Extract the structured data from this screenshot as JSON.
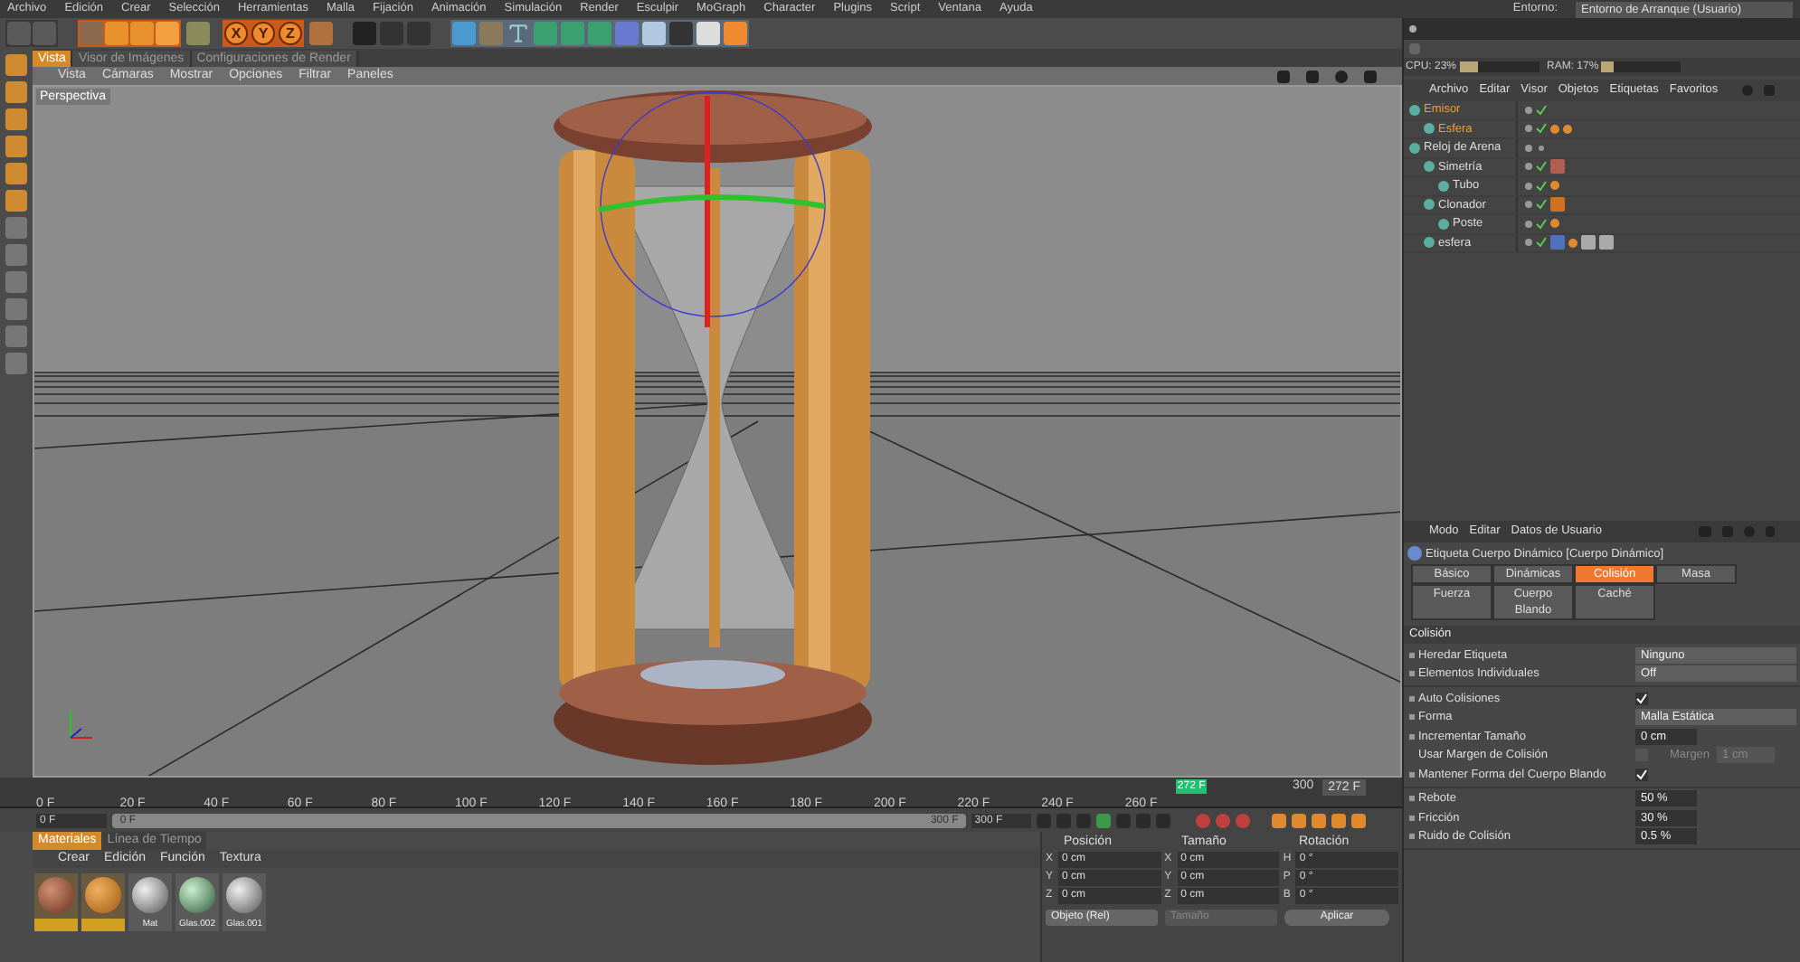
{
  "menu_bar": [
    "Archivo",
    "Edición",
    "Crear",
    "Selección",
    "Herramientas",
    "Malla",
    "Fijación",
    "Animación",
    "Simulación",
    "Render",
    "Esculpir",
    "MoGraph",
    "Character",
    "Plugins",
    "Script",
    "Ventana",
    "Ayuda"
  ],
  "environment": {
    "label": "Entorno:",
    "value": "Entorno de Arranque (Usuario)"
  },
  "axis_locks": [
    {
      "label": "X",
      "on": true
    },
    {
      "label": "Y",
      "on": true
    },
    {
      "label": "Z",
      "on": true
    }
  ],
  "viewport_tabs": [
    {
      "label": "Vista",
      "selected": true
    },
    {
      "label": "Visor de Imágenes",
      "selected": false
    },
    {
      "label": "Configuraciones de Render",
      "selected": false
    }
  ],
  "viewport_menu": [
    "Vista",
    "Cámaras",
    "Mostrar",
    "Opciones",
    "Filtrar",
    "Paneles"
  ],
  "viewport_label": "Perspectiva",
  "timeline": {
    "ticks": [
      "0 F",
      "20 F",
      "40 F",
      "60 F",
      "80 F",
      "100 F",
      "120 F",
      "140 F",
      "160 F",
      "180 F",
      "200 F",
      "220 F",
      "240 F",
      "260 F"
    ],
    "last_tick": "300",
    "marker": "272 F",
    "level": 0.907,
    "current": "272 F"
  },
  "range": {
    "start": "0 F",
    "slider_start": "0 F",
    "slider_end": "300 F",
    "end": "300 F",
    "level": 1
  },
  "meters": [
    {
      "label": "CPU: 23%",
      "level": 0.23
    },
    {
      "label": "RAM: 17%",
      "level": 0.17
    }
  ],
  "object_menu": [
    "Archivo",
    "Editar",
    "Visor",
    "Objetos",
    "Etiquetas",
    "Favoritos"
  ],
  "objects": [
    {
      "name": "Emisor",
      "selected": true,
      "checked": true,
      "children": [
        {
          "name": "Esfera",
          "selected": true,
          "checked": true,
          "tags": [
            {
              "kind": "phong"
            },
            {
              "kind": "dynamics"
            }
          ]
        }
      ]
    },
    {
      "name": "Reloj de Arena",
      "selected": false,
      "checked": false,
      "children": [
        {
          "name": "Simetría",
          "selected": false,
          "checked": true,
          "tags": [
            {
              "kind": "material"
            }
          ],
          "children": [
            {
              "name": "Tubo",
              "selected": false,
              "checked": true,
              "tags": [
                {
                  "kind": "dynamics"
                }
              ]
            }
          ]
        },
        {
          "name": "Clonador",
          "selected": false,
          "checked": true,
          "tags": [
            {
              "kind": "wood"
            }
          ],
          "children": [
            {
              "name": "Poste",
              "selected": false,
              "checked": true,
              "tags": [
                {
                  "kind": "dynamics"
                }
              ]
            }
          ]
        },
        {
          "name": "esfera",
          "selected": false,
          "checked": true,
          "tags": [
            {
              "kind": "glass"
            },
            {
              "kind": "dynamics"
            },
            {
              "kind": "texture"
            },
            {
              "kind": "texture"
            }
          ]
        }
      ]
    }
  ],
  "attribute_menu": [
    "Modo",
    "Editar",
    "Datos de Usuario"
  ],
  "attribute_title": "Etiqueta Cuerpo Dinámico [Cuerpo Dinámico]",
  "attribute_tabs": [
    [
      {
        "label": "Básico",
        "selected": false
      },
      {
        "label": "Dinámicas",
        "selected": false
      },
      {
        "label": "Colisión",
        "selected": true
      },
      {
        "label": "Masa",
        "selected": false
      }
    ],
    [
      {
        "label": "Fuerza",
        "selected": false
      },
      {
        "label": "Cuerpo Blando",
        "selected": false
      },
      {
        "label": "Caché",
        "selected": false
      }
    ]
  ],
  "section": "Colisión",
  "field_groups": [
    [
      {
        "kind": "dropdown",
        "label": "Heredar Etiqueta",
        "value": "Ninguno"
      },
      {
        "kind": "dropdown",
        "label": "Elementos Individuales",
        "value": "Off"
      }
    ],
    [
      {
        "kind": "checkbox",
        "label": "Auto Colisiones",
        "checked": true
      },
      {
        "kind": "dropdown",
        "label": "Forma",
        "value": "Malla Estática"
      },
      {
        "kind": "number",
        "label": "Incrementar Tamaño",
        "value": "0 cm"
      },
      {
        "kind": "margin",
        "label": "Usar Margen de Colisión",
        "checked": false,
        "sub_label": "Margen",
        "value": "1 cm"
      },
      {
        "kind": "checkbox",
        "label": "Mantener Forma del Cuerpo Blando",
        "checked": true
      }
    ],
    [
      {
        "kind": "number",
        "label": "Rebote",
        "value": "50 %"
      },
      {
        "kind": "number",
        "label": "Fricción",
        "value": "30 %"
      },
      {
        "kind": "number",
        "label": "Ruido de Colisión",
        "value": "0.5 %"
      }
    ]
  ],
  "material_tabs": [
    {
      "label": "Materiales",
      "selected": true
    },
    {
      "label": "Línea de Tiempo",
      "selected": false
    }
  ],
  "material_menu": [
    "Crear",
    "Edición",
    "Función",
    "Textura"
  ],
  "materials": [
    {
      "kind": "wood-dark",
      "selected": true
    },
    {
      "kind": "wood-light",
      "selected": true
    },
    {
      "kind": "glass",
      "name": "Mat",
      "selected": false
    },
    {
      "kind": "glass-green",
      "name": "Glas.002",
      "selected": false
    },
    {
      "kind": "glass",
      "name": "Glas.001",
      "selected": false
    }
  ],
  "coordinates": {
    "headers": [
      "Posición",
      "Tamaño",
      "Rotación"
    ],
    "rows": [
      [
        {
          "axis": "X",
          "value": "0 cm"
        },
        {
          "axis": "X",
          "value": "0 cm"
        },
        {
          "axis": "H",
          "value": "0 °"
        }
      ],
      [
        {
          "axis": "Y",
          "value": "0 cm"
        },
        {
          "axis": "Y",
          "value": "0 cm"
        },
        {
          "axis": "P",
          "value": "0 °"
        }
      ],
      [
        {
          "axis": "Z",
          "value": "0 cm"
        },
        {
          "axis": "Z",
          "value": "0 cm"
        },
        {
          "axis": "B",
          "value": "0 °"
        }
      ]
    ],
    "mode": "Objeto (Rel)",
    "size_mode": "Tamaño",
    "apply": "Aplicar"
  }
}
